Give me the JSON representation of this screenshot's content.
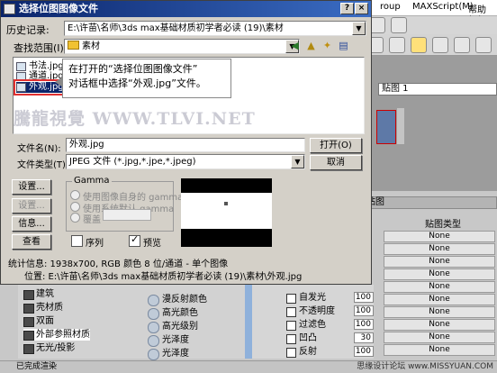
{
  "background_app": {
    "menu": [
      "roup",
      "MAXScript(M)",
      "帮助(H)"
    ],
    "material_dropdown": "贴图 1",
    "maps_panel": {
      "header": "贴图",
      "column_title": "贴图类型",
      "slots": [
        "None",
        "None",
        "None",
        "None",
        "None",
        "None",
        "None",
        "None",
        "None",
        "None",
        "None"
      ]
    },
    "material_types": [
      "建筑",
      "壳材质",
      "双面",
      "外部参照材质",
      "无光/投影"
    ],
    "shader_items": [
      "漫反射颜色",
      "高光颜色",
      "高光级别",
      "光泽度",
      "光泽度"
    ],
    "map_params": [
      {
        "label": "自发光",
        "value": "100"
      },
      {
        "label": "不透明度",
        "value": "100"
      },
      {
        "label": "过滤色",
        "value": "100"
      },
      {
        "label": "凹凸",
        "value": "30"
      },
      {
        "label": "反射",
        "value": "100"
      }
    ],
    "status_text": "已完成渲染",
    "watermark": "思缘设计论坛 www.MISSYUAN.COM"
  },
  "dialog": {
    "title": "选择位图图像文件",
    "history_label": "历史记录:",
    "history_value": "E:\\许苗\\名师\\3ds max基础材质初学者必读 (19)\\素材",
    "lookin_label": "查找范围(I):",
    "lookin_value": "素材",
    "files": [
      "书法.jpg",
      "通道.jpg",
      "外观.jpg"
    ],
    "selected_file_index": 2,
    "callout_lines": [
      "在打开的“选择位图图像文件”",
      "对话框中选择“外观.jpg”文件。"
    ],
    "overlay_watermark": "騰龍視覺 WWW.TLVI.NET",
    "filename_label": "文件名(N):",
    "filename_value": "外观.jpg",
    "filetype_label": "文件类型(T):",
    "filetype_value": "JPEG 文件 (*.jpg,*.jpe,*.jpeg)",
    "open_button": "打开(O)",
    "cancel_button": "取消",
    "setup_button": "设置...",
    "settings_button": "设置...",
    "info_button": "信息...",
    "view_button": "查看",
    "gamma": {
      "title": "Gamma",
      "opt_own": "使用图像自身的 gamma",
      "opt_system": "使用系统默认 gamma",
      "opt_override": "覆盖"
    },
    "sequence_label": "序列",
    "sequence_checked": false,
    "preview_label": "预览",
    "preview_checked": true,
    "stats_line": "统计信息:  1938x700, RGB 颜色 8 位/通道 - 单个图像",
    "location_line": "位置: E:\\许苗\\名师\\3ds max基础材质初学者必读 (19)\\素材\\外观.jpg"
  }
}
